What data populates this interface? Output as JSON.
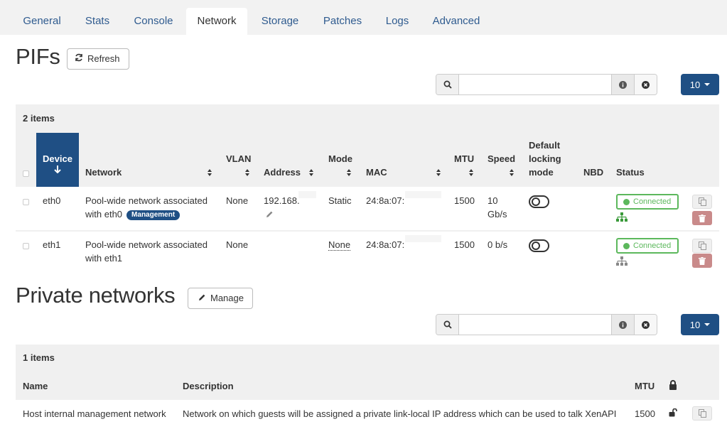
{
  "tabs": [
    "General",
    "Stats",
    "Console",
    "Network",
    "Storage",
    "Patches",
    "Logs",
    "Advanced"
  ],
  "active_tab": "Network",
  "pifs": {
    "title": "PIFs",
    "refresh_label": "Refresh",
    "search_value": "",
    "page_size": "10",
    "count_label": "2 items",
    "headers": {
      "device": "Device",
      "network": "Network",
      "vlan": "VLAN",
      "address": "Address",
      "mode": "Mode",
      "mac": "MAC",
      "mtu": "MTU",
      "speed": "Speed",
      "locking_1": "Default",
      "locking_2": "locking",
      "locking_3": "mode",
      "nbd": "NBD",
      "status": "Status"
    },
    "rows": [
      {
        "device": "eth0",
        "network_line1": "Pool-wide network associated",
        "network_line2": "with eth0",
        "badge": "Management",
        "vlan": "None",
        "address": "192.168.",
        "mode": "Static",
        "mac": "24:8a:07:",
        "mtu": "1500",
        "speed_line1": "10",
        "speed_line2": "Gb/s",
        "status": "Connected"
      },
      {
        "device": "eth1",
        "network_line1": "Pool-wide network associated",
        "network_line2": "with eth1",
        "vlan": "None",
        "address": "",
        "mode": "None",
        "mac": "24:8a:07:",
        "mtu": "1500",
        "speed_line1": "0 b/s",
        "status": "Connected"
      }
    ]
  },
  "private_networks": {
    "title": "Private networks",
    "manage_label": "Manage",
    "search_value": "",
    "page_size": "10",
    "count_label": "1 items",
    "headers": {
      "name": "Name",
      "description": "Description",
      "mtu": "MTU"
    },
    "rows": [
      {
        "name": "Host internal management network",
        "description": "Network on which guests will be assigned a private link-local IP address which can be used to talk XenAPI",
        "mtu": "1500"
      }
    ]
  },
  "colors": {
    "primary": "#1f4f84",
    "tab_link": "#2f5b8f",
    "success": "#5cb85c",
    "danger_muted": "#c98a8a"
  },
  "icons": [
    "refresh-icon",
    "search-icon",
    "info-icon",
    "clear-icon",
    "sort-desc-icon",
    "sort-icon",
    "edit-icon",
    "network-tree-icon",
    "copy-icon",
    "trash-icon",
    "pencil-icon",
    "lock-icon",
    "unlock-icon"
  ]
}
